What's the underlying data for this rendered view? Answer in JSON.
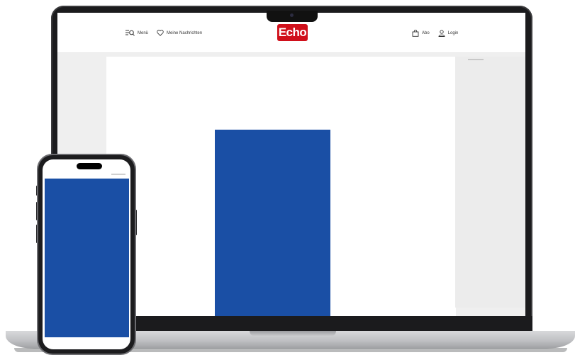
{
  "header": {
    "menu_label": "Menü",
    "favorites_label": "Meine Nachrichten",
    "logo_text": "Echo",
    "subscription_label": "Abo",
    "login_label": "Login"
  },
  "colors": {
    "brand_red": "#d0101b",
    "ad_blue": "#1a4fa5",
    "device_frame": "#1b1b1d"
  },
  "icons": {
    "menu": "menu-search-icon",
    "favorites": "heart-icon",
    "subscription": "bag-icon",
    "login": "user-icon"
  }
}
